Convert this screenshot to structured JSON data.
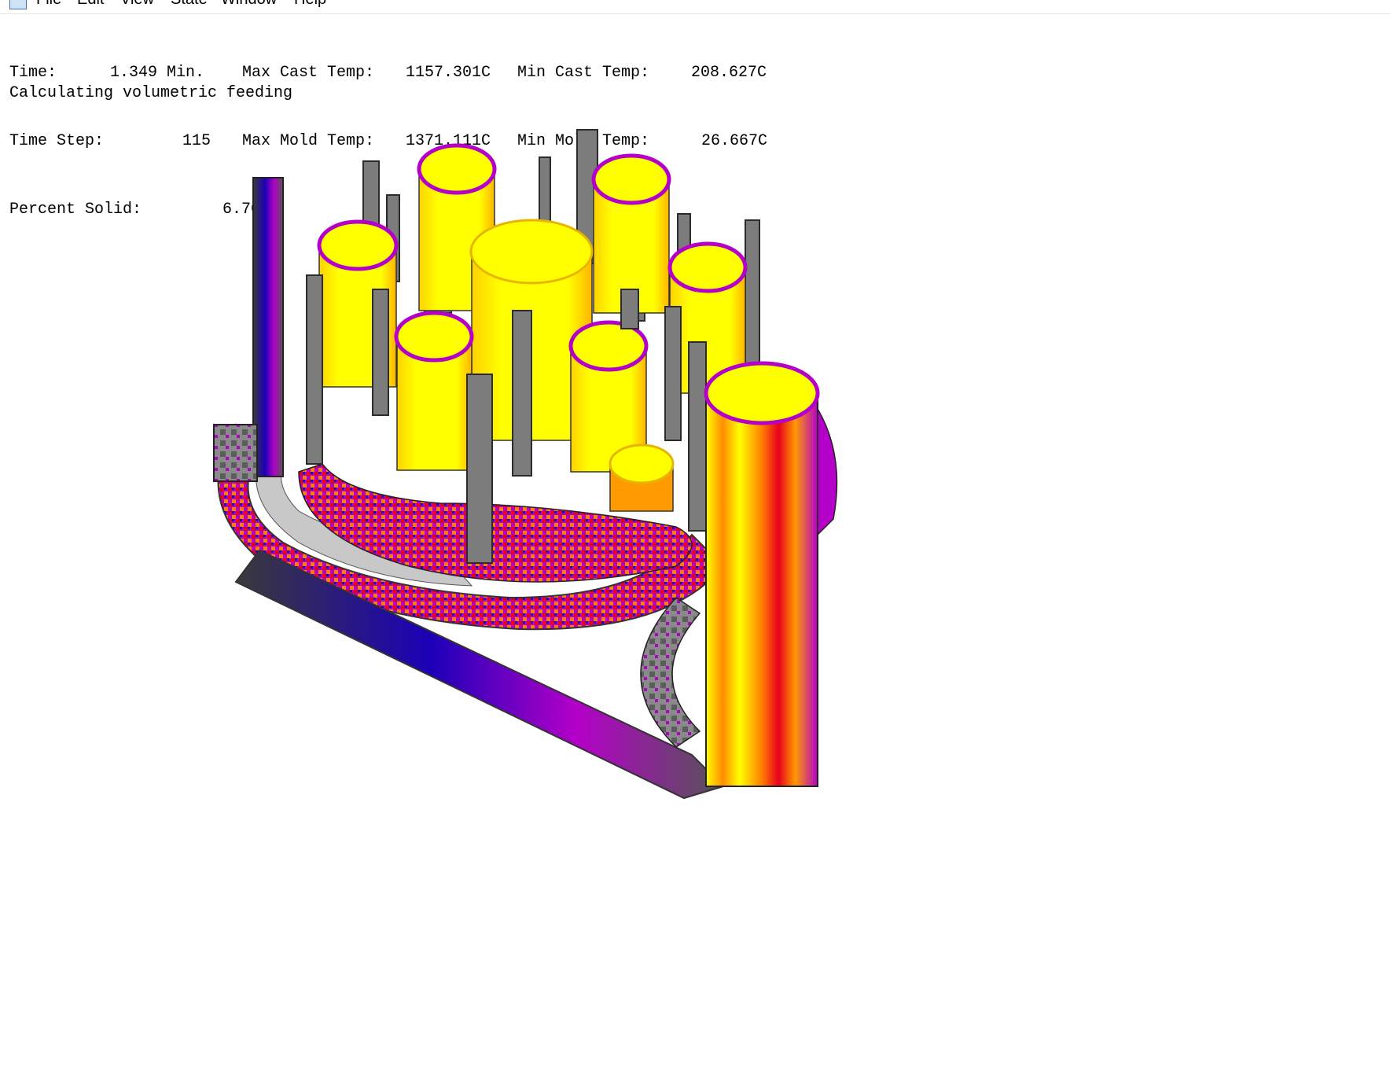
{
  "menu": [
    "File",
    "Edit",
    "View",
    "State",
    "Window",
    "Help"
  ],
  "readout": {
    "time_label": "Time:",
    "time_value": "1.349 Min.",
    "timestep_label": "Time Step:",
    "timestep_value": "115",
    "percent_solid_label": "Percent Solid:",
    "percent_solid_value": "6.70 %",
    "max_cast_label": "Max Cast Temp:",
    "max_cast_value": "1157.301C",
    "max_mold_label": "Max Mold Temp:",
    "max_mold_value": "1371.111C",
    "min_cast_label": "Min Cast Temp:",
    "min_cast_value": "208.627C",
    "min_mold_label": "Min Mold Temp:",
    "min_mold_value": "26.667C"
  },
  "status": "Calculating volumetric feeding",
  "colors": {
    "hot": "#ffff00",
    "warm": "#ff7f00",
    "mid": "#e8001e",
    "cool": "#b400c8",
    "cold": "#1c00b8",
    "mold": "#808080",
    "mold_light": "#c8c8c8"
  }
}
